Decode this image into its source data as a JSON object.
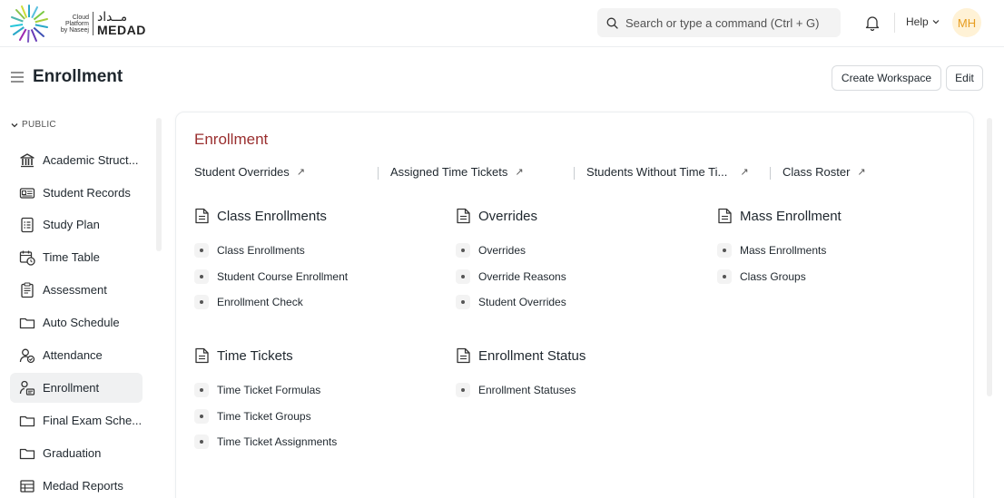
{
  "brand": {
    "small_lines": [
      "Cloud",
      "Platform",
      "by Naseej"
    ],
    "arabic": "مــداد",
    "name": "MEDAD"
  },
  "navbar": {
    "search_placeholder": "Search or type a command (Ctrl + G)",
    "help_label": "Help",
    "avatar_initials": "MH"
  },
  "page": {
    "title": "Enrollment",
    "create_workspace_label": "Create Workspace",
    "edit_label": "Edit"
  },
  "sidebar": {
    "section_label": "PUBLIC",
    "items": [
      {
        "label": "Academic Struct...",
        "icon": "bank-icon"
      },
      {
        "label": "Student Records",
        "icon": "id-card-icon"
      },
      {
        "label": "Study Plan",
        "icon": "checklist-icon"
      },
      {
        "label": "Time Table",
        "icon": "calendar-clock-icon"
      },
      {
        "label": "Assessment",
        "icon": "assessment-icon"
      },
      {
        "label": "Auto Schedule",
        "icon": "folder-icon"
      },
      {
        "label": "Attendance",
        "icon": "user-check-icon"
      },
      {
        "label": "Enrollment",
        "icon": "user-card-icon",
        "active": true
      },
      {
        "label": "Final Exam Sche...",
        "icon": "folder-icon"
      },
      {
        "label": "Graduation",
        "icon": "folder-icon"
      },
      {
        "label": "Medad Reports",
        "icon": "table-icon"
      }
    ]
  },
  "workspace": {
    "title": "Enrollment",
    "shortcuts": [
      {
        "label": "Student Overrides"
      },
      {
        "label": "Assigned Time Tickets"
      },
      {
        "label": "Students Without Time Ti..."
      },
      {
        "label": "Class Roster"
      }
    ],
    "cards": [
      {
        "title": "Class Enrollments",
        "links": [
          "Class Enrollments",
          "Student Course Enrollment",
          "Enrollment Check"
        ]
      },
      {
        "title": "Overrides",
        "links": [
          "Overrides",
          "Override Reasons",
          "Student Overrides"
        ]
      },
      {
        "title": "Mass Enrollment",
        "links": [
          "Mass Enrollments",
          "Class Groups"
        ]
      },
      {
        "title": "Time Tickets",
        "links": [
          "Time Ticket Formulas",
          "Time Ticket Groups",
          "Time Ticket Assignments"
        ]
      },
      {
        "title": "Enrollment Status",
        "links": [
          "Enrollment Statuses"
        ]
      }
    ]
  },
  "colors": {
    "workspace_title": "#9a2f2f",
    "avatar_bg": "#fff2d6",
    "avatar_text": "#e69c1f",
    "active_item_bg": "#f0f1f2"
  }
}
